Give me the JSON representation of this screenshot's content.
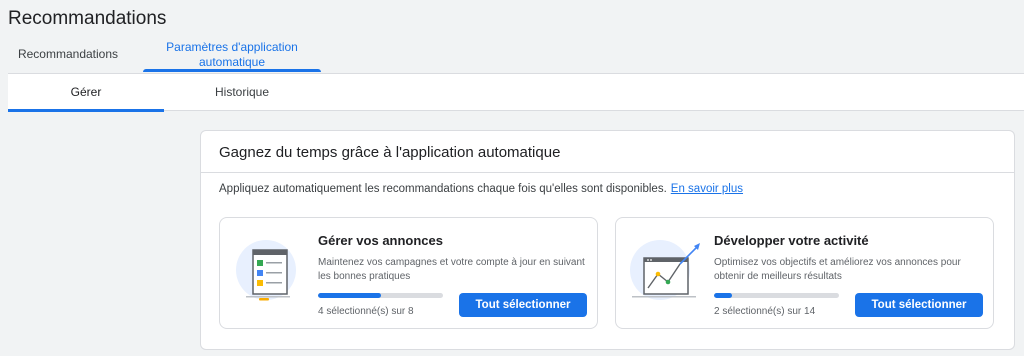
{
  "page": {
    "title": "Recommandations"
  },
  "tabs": [
    {
      "label": "Recommandations",
      "active": false
    },
    {
      "label_line1": "Paramètres d'application",
      "label_line2": "automatique",
      "active": true
    }
  ],
  "subtabs": [
    {
      "label": "Gérer",
      "active": true
    },
    {
      "label": "Historique",
      "active": false
    }
  ],
  "panel": {
    "title": "Gagnez du temps grâce à l'application automatique",
    "description": "Appliquez automatiquement les recommandations chaque fois qu'elles sont disponibles.",
    "link": "En savoir plus"
  },
  "cards": [
    {
      "title": "Gérer vos annonces",
      "description": "Maintenez vos campagnes et votre compte à jour en suivant les bonnes pratiques",
      "progress_fraction": 0.5,
      "count_text": "4 sélectionné(s) sur 8",
      "button": "Tout sélectionner",
      "icon": "checklist-illustration"
    },
    {
      "title": "Développer votre activité",
      "description": "Optimisez vos objectifs et améliorez vos annonces pour obtenir de meilleurs résultats",
      "progress_fraction": 0.1429,
      "count_text": "2 sélectionné(s) sur 14",
      "button": "Tout sélectionner",
      "icon": "growth-chart-illustration"
    }
  ],
  "colors": {
    "accent": "#1a73e8",
    "background": "#f1f3f4",
    "border": "#dadce0"
  }
}
